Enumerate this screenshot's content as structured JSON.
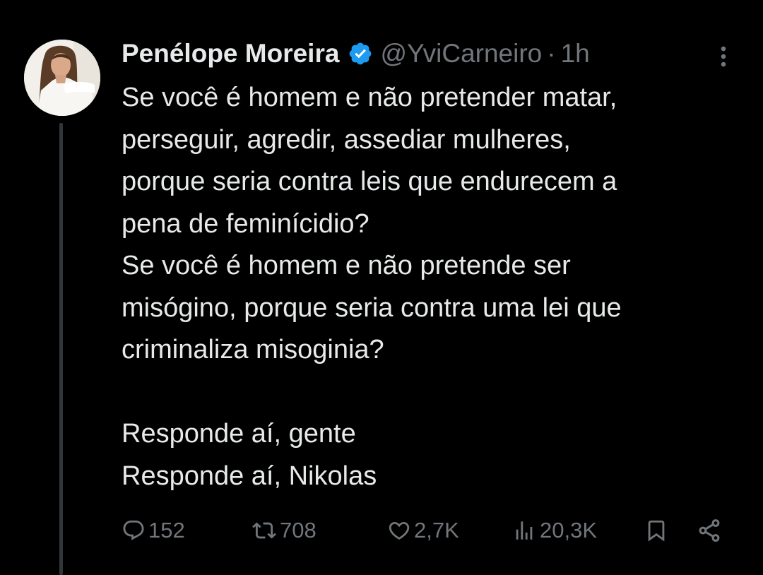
{
  "tweet": {
    "author": {
      "display_name": "Penélope Moreira",
      "handle": "@YviCarneiro",
      "separator": "·",
      "time": "1h",
      "verified_icon": "verified-badge-icon",
      "verified_color": "#1d9bf0"
    },
    "text_lines": [
      "Se você é homem e não pretender matar,",
      "perseguir, agredir, assediar mulheres,",
      "porque seria contra leis que endurecem a",
      "pena de feminícidio?",
      "Se você é homem e não pretende ser",
      "misógino, porque seria contra uma lei que",
      "criminaliza misoginia?",
      "",
      "Responde aí, gente",
      "Responde aí, Nikolas"
    ],
    "actions": {
      "reply": {
        "icon": "reply-icon",
        "count": "152"
      },
      "retweet": {
        "icon": "retweet-icon",
        "count": "708"
      },
      "like": {
        "icon": "heart-icon",
        "count": "2,7K"
      },
      "views": {
        "icon": "views-icon",
        "count": "20,3K"
      },
      "bookmark": {
        "icon": "bookmark-icon"
      },
      "share": {
        "icon": "share-icon"
      }
    }
  },
  "colors": {
    "background": "#000000",
    "text": "#e7e9ea",
    "muted": "#71767b",
    "thread_line": "#333639",
    "verified": "#1d9bf0"
  }
}
